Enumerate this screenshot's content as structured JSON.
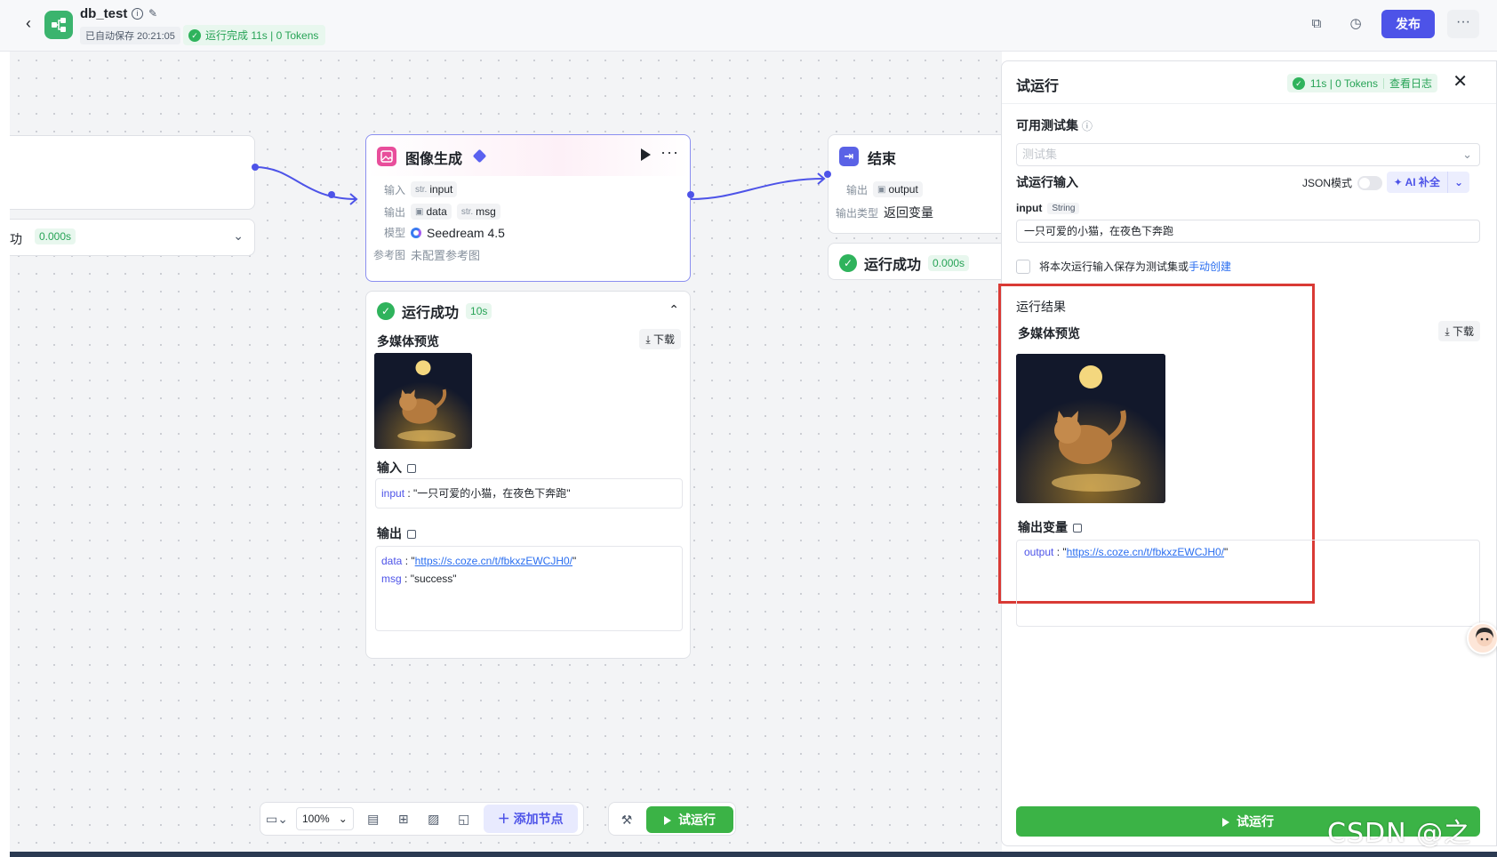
{
  "header": {
    "app_title": "db_test",
    "autosave": "已自动保存 20:21:05",
    "run_status": "运行完成 11s | 0 Tokens",
    "publish_label": "发布"
  },
  "start_node": {
    "status_label": "功",
    "time": "0.000s"
  },
  "image_node": {
    "title": "图像生成",
    "input_key": "输入",
    "input_var": "input",
    "output_key": "输出",
    "output_var1": "data",
    "output_var2": "msg",
    "model_key": "模型",
    "model_value": "Seedream 4.5",
    "ref_key": "参考图",
    "ref_value": "未配置参考图",
    "type_str": "str.",
    "result_title": "运行成功",
    "result_time": "10s",
    "media_preview": "多媒体预览",
    "download": "下载",
    "input_section": "输入",
    "input_code_key": "input",
    "input_code_val": "\"一只可爱的小猫，在夜色下奔跑\"",
    "output_section": "输出",
    "out_data_key": "data",
    "out_data_val": "https://s.coze.cn/t/fbkxzEWCJH0/",
    "out_msg_key": "msg",
    "out_msg_val": "\"success\""
  },
  "end_node": {
    "title": "结束",
    "output_key": "输出",
    "output_var": "output",
    "output_type_key": "输出类型",
    "output_type_val": "返回变量",
    "result_title": "运行成功",
    "result_time": "0.000s"
  },
  "toolbar": {
    "zoom": "100%",
    "add_node": "添加节点",
    "test_run": "试运行"
  },
  "panel": {
    "title": "试运行",
    "badge_stats": "11s | 0 Tokens",
    "badge_log": "查看日志",
    "testset_label": "可用测试集",
    "testset_placeholder": "测试集",
    "run_input_label": "试运行输入",
    "json_mode": "JSON模式",
    "ai_fill": "AI 补全",
    "input_name": "input",
    "input_type": "String",
    "input_value": "一只可爱的小猫，在夜色下奔跑",
    "save_text": "将本次运行输入保存为测试集或",
    "manual_create": "手动创建",
    "result_label": "运行结果",
    "media_preview": "多媒体预览",
    "download": "下载",
    "output_var_label": "输出变量",
    "output_key": "output",
    "output_val": "https://s.coze.cn/t/fbkxzEWCJH0/",
    "run_button": "试运行"
  },
  "watermark": "CSDN @之歆",
  "colors": {
    "accent": "#4d53e8",
    "success": "#2fb35c",
    "run_green": "#3bb346",
    "highlight_red": "#d93a35"
  }
}
